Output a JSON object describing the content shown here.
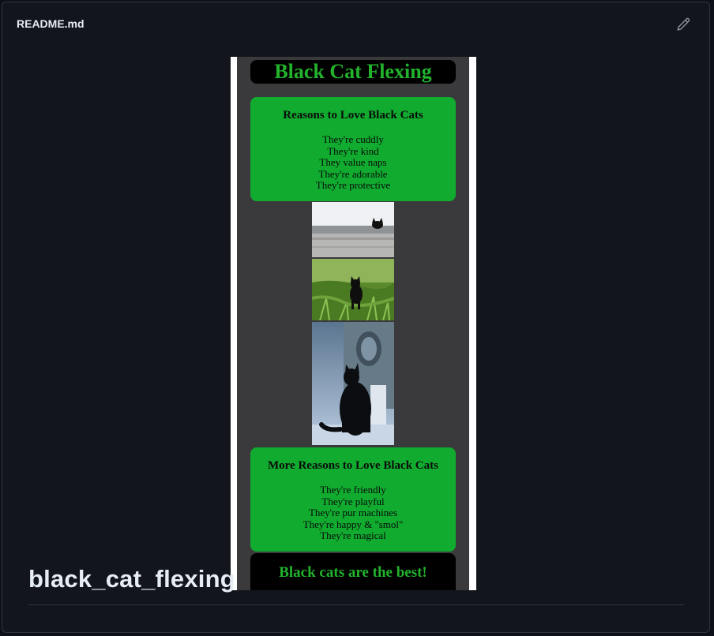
{
  "readme": {
    "filename": "README.md",
    "edit_icon": "pencil-icon"
  },
  "preview": {
    "title": "Black Cat Flexing",
    "card1": {
      "heading": "Reasons to Love Black Cats",
      "items": [
        "They're cuddly",
        "They're kind",
        "They value naps",
        "They're adorable",
        "They're protective"
      ]
    },
    "card2": {
      "heading": "More Reasons to Love Black Cats",
      "items": [
        "They're friendly",
        "They're playful",
        "They're pur machines",
        "They're happy & \"smol\"",
        "They're magical"
      ]
    },
    "footer": "Black cats are the best!",
    "colors": {
      "green": "#10ab2f",
      "title_green": "#22b32c",
      "panel": "#3a393b"
    }
  },
  "repo": {
    "name": "black_cat_flexing"
  }
}
